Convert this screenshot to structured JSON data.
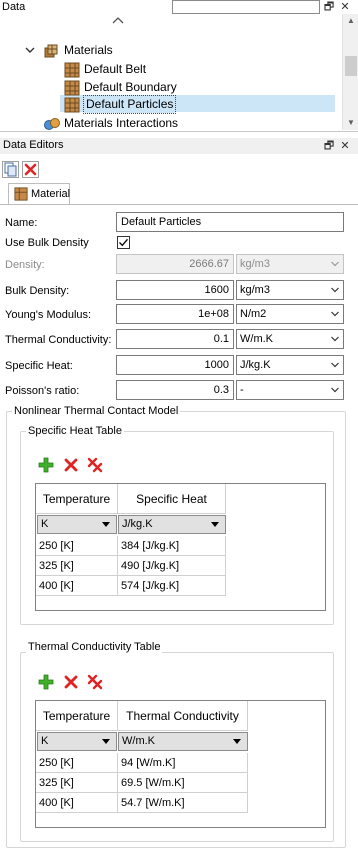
{
  "data_panel": {
    "title": "Data",
    "pin_glyph": "🗗",
    "close_glyph": "✕",
    "tree": {
      "materials": "Materials",
      "default_belt": "Default Belt",
      "default_boundary": "Default Boundary",
      "default_particles": "Default Particles",
      "materials_interactions": "Materials Interactions"
    },
    "scroll_up": "▲",
    "scroll_down": "▼"
  },
  "data_editors": {
    "title": "Data Editors",
    "pin_glyph": "🗗",
    "close_glyph": "✕",
    "tab": "Material",
    "properties": {
      "name_label": "Name:",
      "name_value": "Default Particles",
      "use_bulk_label": "Use Bulk Density",
      "use_bulk_checked": true,
      "density_label": "Density:",
      "density_value": "2666.67",
      "density_unit": "kg/m3",
      "bulk_density_label": "Bulk Density:",
      "bulk_density_value": "1600",
      "bulk_density_unit": "kg/m3",
      "youngs_label": "Young's Modulus:",
      "youngs_value": "1e+08",
      "youngs_unit": "N/m2",
      "thermal_cond_label": "Thermal Conductivity:",
      "thermal_cond_value": "0.1",
      "thermal_cond_unit": "W/m.K",
      "specific_heat_label": "Specific Heat:",
      "specific_heat_value": "1000",
      "specific_heat_unit": "J/kg.K",
      "poisson_label": "Poisson's ratio:",
      "poisson_value": "0.3",
      "poisson_unit": "-"
    },
    "nonlinear_group": "Nonlinear Thermal Contact Model",
    "specific_heat_table": {
      "title": "Specific Heat Table",
      "headers": [
        "Temperature",
        "Specific Heat"
      ],
      "units": [
        "K",
        "J/kg.K"
      ],
      "rows": [
        [
          "250 [K]",
          "384 [J/kg.K]"
        ],
        [
          "325 [K]",
          "490 [J/kg.K]"
        ],
        [
          "400 [K]",
          "574 [J/kg.K]"
        ]
      ]
    },
    "thermal_conductivity_table": {
      "title": "Thermal Conductivity Table",
      "headers": [
        "Temperature",
        "Thermal Conductivity"
      ],
      "units": [
        "K",
        "W/m.K"
      ],
      "rows": [
        [
          "250 [K]",
          "94 [W/m.K]"
        ],
        [
          "325 [K]",
          "69.5 [W/m.K]"
        ],
        [
          "400 [K]",
          "54.7 [W/m.K]"
        ]
      ]
    }
  },
  "colors": {
    "add": "#2e9e1a",
    "delete": "#e02424",
    "selection": "#cde6f7"
  }
}
